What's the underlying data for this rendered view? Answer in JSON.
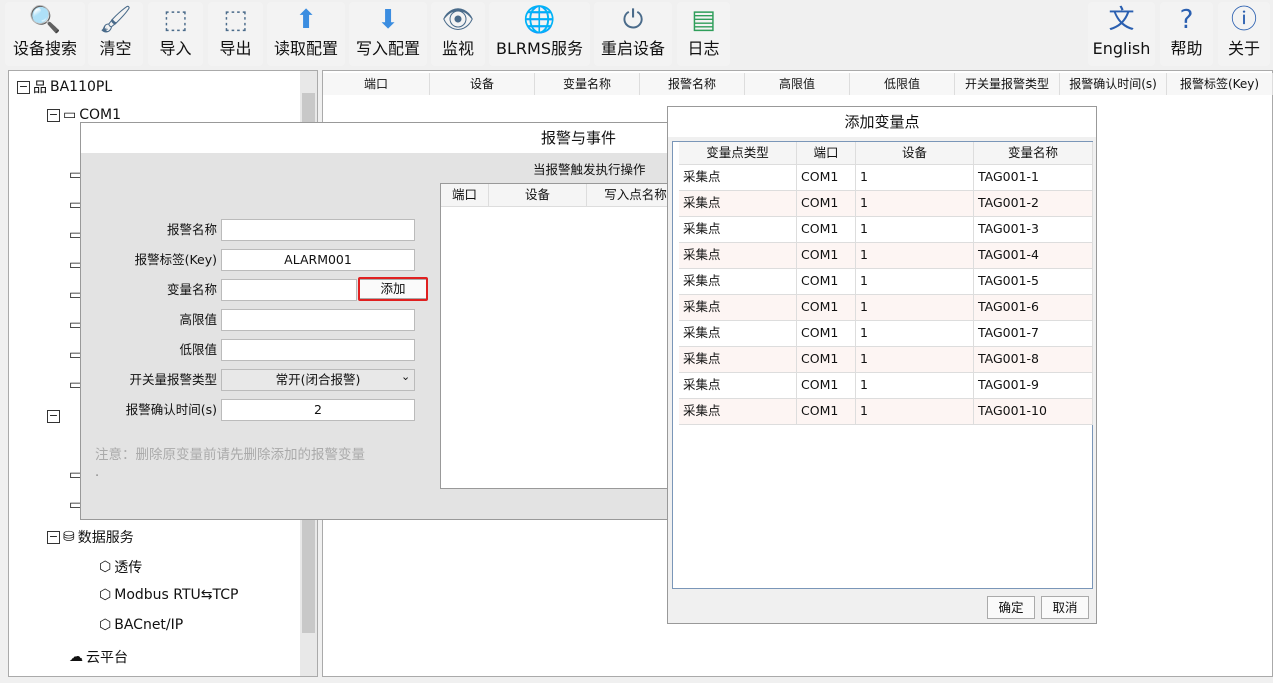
{
  "toolbar": {
    "items": [
      {
        "label": "设备搜索",
        "icon": "search-icon"
      },
      {
        "label": "清空",
        "icon": "brush-icon"
      },
      {
        "label": "导入",
        "icon": "import-icon"
      },
      {
        "label": "导出",
        "icon": "export-icon"
      },
      {
        "label": "读取配置",
        "icon": "upload-icon"
      },
      {
        "label": "写入配置",
        "icon": "download-icon"
      },
      {
        "label": "监视",
        "icon": "eye-icon"
      },
      {
        "label": "BLRMS服务",
        "icon": "globe-icon"
      },
      {
        "label": "重启设备",
        "icon": "power-icon"
      },
      {
        "label": "日志",
        "icon": "log-icon"
      }
    ],
    "right": [
      {
        "label": "English",
        "icon": "language-icon"
      },
      {
        "label": "帮助",
        "icon": "help-icon"
      },
      {
        "label": "关于",
        "icon": "info-icon"
      }
    ]
  },
  "tree": {
    "root": "BA110PL",
    "com1": "COM1",
    "data_service": "数据服务",
    "passthrough": "透传",
    "modbus": "Modbus RTU⇆TCP",
    "bacnet": "BACnet/IP",
    "cloud": "云平台"
  },
  "main_table": {
    "columns": [
      "端口",
      "设备",
      "变量名称",
      "报警名称",
      "高限值",
      "低限值",
      "开关量报警类型",
      "报警确认时间(s)",
      "报警标签(Key)"
    ]
  },
  "alarm_dialog": {
    "title": "报警与事件",
    "action_title": "当报警触发执行操作",
    "action_columns": [
      "端口",
      "设备",
      "写入点名称"
    ],
    "fields": {
      "name_label": "报警名称",
      "name_value": "",
      "key_label": "报警标签(Key)",
      "key_value": "ALARM001",
      "var_label": "变量名称",
      "var_value": "",
      "add_button": "添加",
      "high_label": "高限值",
      "high_value": "",
      "low_label": "低限值",
      "low_value": "",
      "switch_label": "开关量报警类型",
      "switch_value": "常开(闭合报警)",
      "confirm_label": "报警确认时间(s)",
      "confirm_value": "2"
    },
    "note": "注意：删除原变量前请先删除添加的报警变量",
    "note2": "."
  },
  "add_dialog": {
    "title": "添加变量点",
    "columns": [
      "变量点类型",
      "端口",
      "设备",
      "变量名称"
    ],
    "rows": [
      [
        "采集点",
        "COM1",
        "1",
        "TAG001-1"
      ],
      [
        "采集点",
        "COM1",
        "1",
        "TAG001-2"
      ],
      [
        "采集点",
        "COM1",
        "1",
        "TAG001-3"
      ],
      [
        "采集点",
        "COM1",
        "1",
        "TAG001-4"
      ],
      [
        "采集点",
        "COM1",
        "1",
        "TAG001-5"
      ],
      [
        "采集点",
        "COM1",
        "1",
        "TAG001-6"
      ],
      [
        "采集点",
        "COM1",
        "1",
        "TAG001-7"
      ],
      [
        "采集点",
        "COM1",
        "1",
        "TAG001-8"
      ],
      [
        "采集点",
        "COM1",
        "1",
        "TAG001-9"
      ],
      [
        "采集点",
        "COM1",
        "1",
        "TAG001-10"
      ]
    ],
    "ok": "确定",
    "cancel": "取消"
  },
  "colors": {
    "highlight": "#e02020",
    "row_alt": "#fdf5f3"
  }
}
